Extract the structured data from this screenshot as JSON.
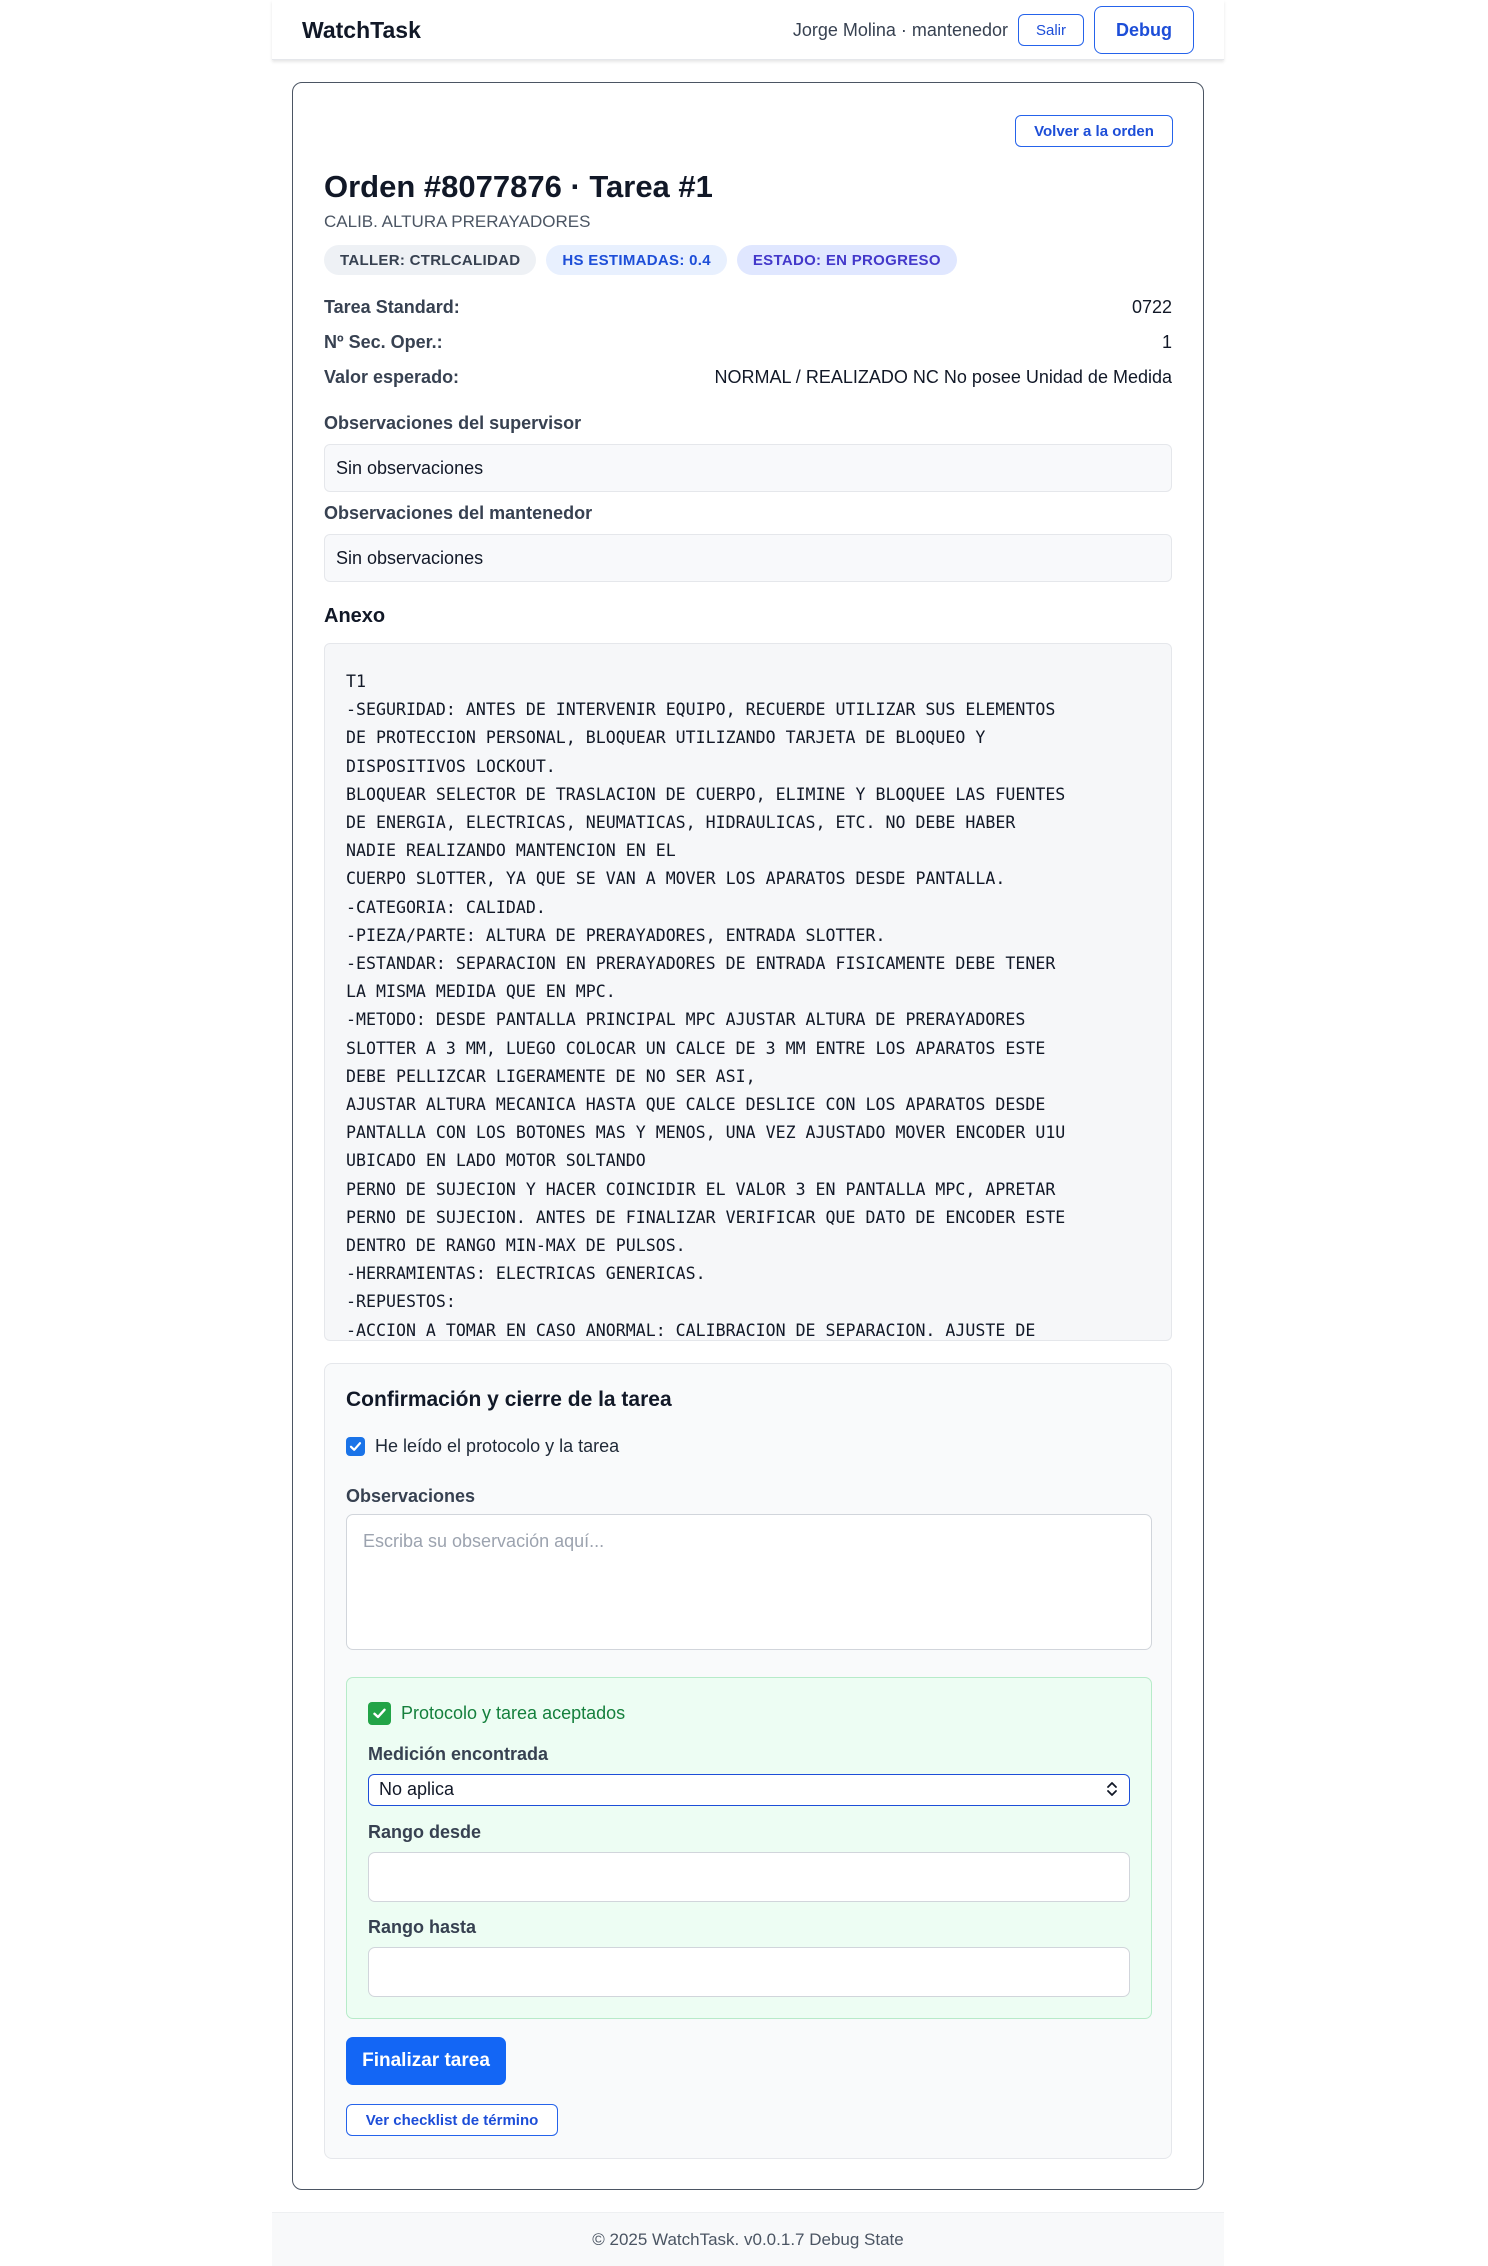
{
  "navbar": {
    "brand": "WatchTask",
    "user": "Jorge Molina · mantenedor",
    "logout_label": "Salir",
    "debug_label": "Debug"
  },
  "header": {
    "back_label": "Volver a la orden",
    "title": "Orden #8077876 · Tarea #1",
    "subtitle": "CALIB. ALTURA PRERAYADORES",
    "badges": {
      "taller": "TALLER: CTRLCALIDAD",
      "hours": "HS ESTIMADAS: 0.4",
      "status": "ESTADO: EN PROGRESO"
    }
  },
  "details": [
    {
      "label": "Tarea Standard:",
      "value": "0722"
    },
    {
      "label": "Nº Sec. Oper.:",
      "value": "1"
    },
    {
      "label": "Valor esperado:",
      "value": "NORMAL / REALIZADO NC No posee Unidad de Medida"
    }
  ],
  "observations": {
    "supervisor_label": "Observaciones del supervisor",
    "supervisor_value": "Sin observaciones",
    "maintainer_label": "Observaciones del mantenedor",
    "maintainer_value": "Sin observaciones"
  },
  "annex": {
    "label": "Anexo",
    "lines": [
      "T1",
      "-SEGURIDAD: ANTES DE INTERVENIR EQUIPO, RECUERDE UTILIZAR SUS ELEMENTOS",
      "DE PROTECCION PERSONAL, BLOQUEAR UTILIZANDO TARJETA DE BLOQUEO Y",
      "DISPOSITIVOS LOCKOUT.",
      "BLOQUEAR SELECTOR DE TRASLACION DE CUERPO, ELIMINE Y BLOQUEE LAS FUENTES",
      "DE ENERGIA, ELECTRICAS, NEUMATICAS, HIDRAULICAS, ETC. NO DEBE HABER",
      "NADIE REALIZANDO MANTENCION EN EL",
      "CUERPO SLOTTER, YA QUE SE VAN A MOVER LOS APARATOS DESDE PANTALLA.",
      "-CATEGORIA: CALIDAD.",
      "-PIEZA/PARTE: ALTURA DE PRERAYADORES, ENTRADA SLOTTER.",
      "-ESTANDAR: SEPARACION EN PRERAYADORES DE ENTRADA FISICAMENTE DEBE TENER",
      "LA MISMA MEDIDA QUE EN MPC.",
      "-METODO: DESDE PANTALLA PRINCIPAL MPC AJUSTAR ALTURA DE PRERAYADORES",
      "SLOTTER A 3 MM, LUEGO COLOCAR UN CALCE DE 3 MM ENTRE LOS APARATOS ESTE",
      "DEBE PELLIZCAR LIGERAMENTE DE NO SER ASI,",
      "AJUSTAR ALTURA MECANICA HASTA QUE CALCE DESLICE CON LOS APARATOS DESDE",
      "PANTALLA CON LOS BOTONES MAS Y MENOS, UNA VEZ AJUSTADO MOVER ENCODER U1U",
      "UBICADO EN LADO MOTOR SOLTANDO",
      "PERNO DE SUJECION Y HACER COINCIDIR EL VALOR 3 EN PANTALLA MPC, APRETAR",
      "PERNO DE SUJECION. ANTES DE FINALIZAR VERIFICAR QUE DATO DE ENCODER ESTE",
      "DENTRO DE RANGO MIN-MAX DE PULSOS.",
      "-HERRAMIENTAS: ELECTRICAS GENERICAS.",
      "-REPUESTOS:",
      "-ACCION A TOMAR EN CASO ANORMAL: CALIBRACION DE SEPARACION. AJUSTE DE"
    ]
  },
  "confirm": {
    "title": "Confirmación y cierre de la tarea",
    "read_checkbox_label": "He leído el protocolo y la tarea",
    "read_checked": true,
    "obs_label": "Observaciones",
    "obs_placeholder": "Escriba su observación aquí...",
    "accepted_text": "Protocolo y tarea aceptados",
    "measure_label": "Medición encontrada",
    "measure_value": "No aplica",
    "range_from_label": "Rango desde",
    "range_to_label": "Rango hasta",
    "finish_label": "Finalizar tarea",
    "checklist_label": "Ver checklist de término"
  },
  "footer": {
    "text": "© 2025 WatchTask. v0.0.1.7 Debug State"
  },
  "colors": {
    "accent": "#1366f5",
    "success": "#15803d"
  }
}
